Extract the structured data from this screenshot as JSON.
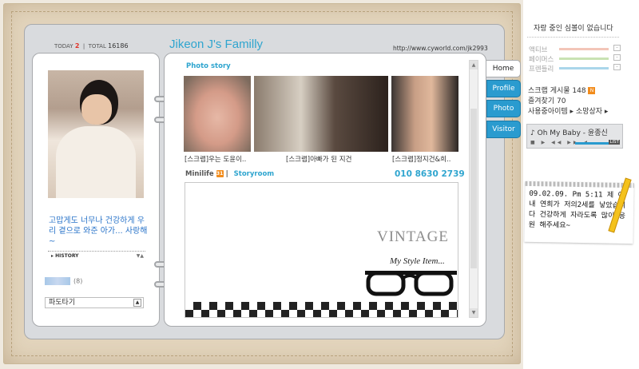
{
  "counter": {
    "today_label": "TODAY",
    "today_value": "2",
    "total_label": "TOTAL",
    "total_value": "16186",
    "sep": "|"
  },
  "header": {
    "title": "Jikeon J's Familly",
    "url": "http://www.cyworld.com/jk2993"
  },
  "profile": {
    "intro": "고맙게도 너무나 건강하게 우리 곁으로 와준 아가... 사랑해~",
    "history_label": "HISTORY",
    "friends_count": "(8)",
    "wave_label": "파도타기"
  },
  "main": {
    "section_title": "Photo story",
    "photos": [
      {
        "caption": "[스크랩]우는 도윤이.."
      },
      {
        "caption": "[스크랩]아빠가 된 지건"
      },
      {
        "caption": "[스크랩]정지건&희.."
      }
    ],
    "minilife_label": "Minilife",
    "minilife_count": "31",
    "separator": "|",
    "storyroom_label": "Storyroom",
    "phone": "010 8630 2739",
    "storyroom": {
      "vintage": "VINTAGE",
      "tagline": "My Style Item..."
    }
  },
  "tabs": [
    {
      "label": "Home",
      "active": true
    },
    {
      "label": "Profile",
      "active": false
    },
    {
      "label": "Photo",
      "active": false
    },
    {
      "label": "Visitor",
      "active": false
    }
  ],
  "side": {
    "heading": "자랑 중인 심볼이 없습니다",
    "moods": [
      {
        "label": "액티브",
        "color": "#f3c5b8"
      },
      {
        "label": "페이머스",
        "color": "#c9e2b3"
      },
      {
        "label": "프렌들리",
        "color": "#aad6ea"
      }
    ],
    "scrap_posts": {
      "label": "스크랩 게시물",
      "value": "148"
    },
    "favorites": {
      "label": "즐겨찾기",
      "value": "70"
    },
    "items": {
      "label": "사용중아이템",
      "shop": "소망상자"
    },
    "player": {
      "song": "Oh My Baby - 윤종신",
      "controls": "■ ▶ ◀◀ ▶▶ ◀",
      "list": "LIST"
    },
    "note": "09.02.09. Pm 5:11 제 아내 연희가 저의2세를 낳았습니다 건강하게 자라도록 많이 응원 해주세요~"
  }
}
